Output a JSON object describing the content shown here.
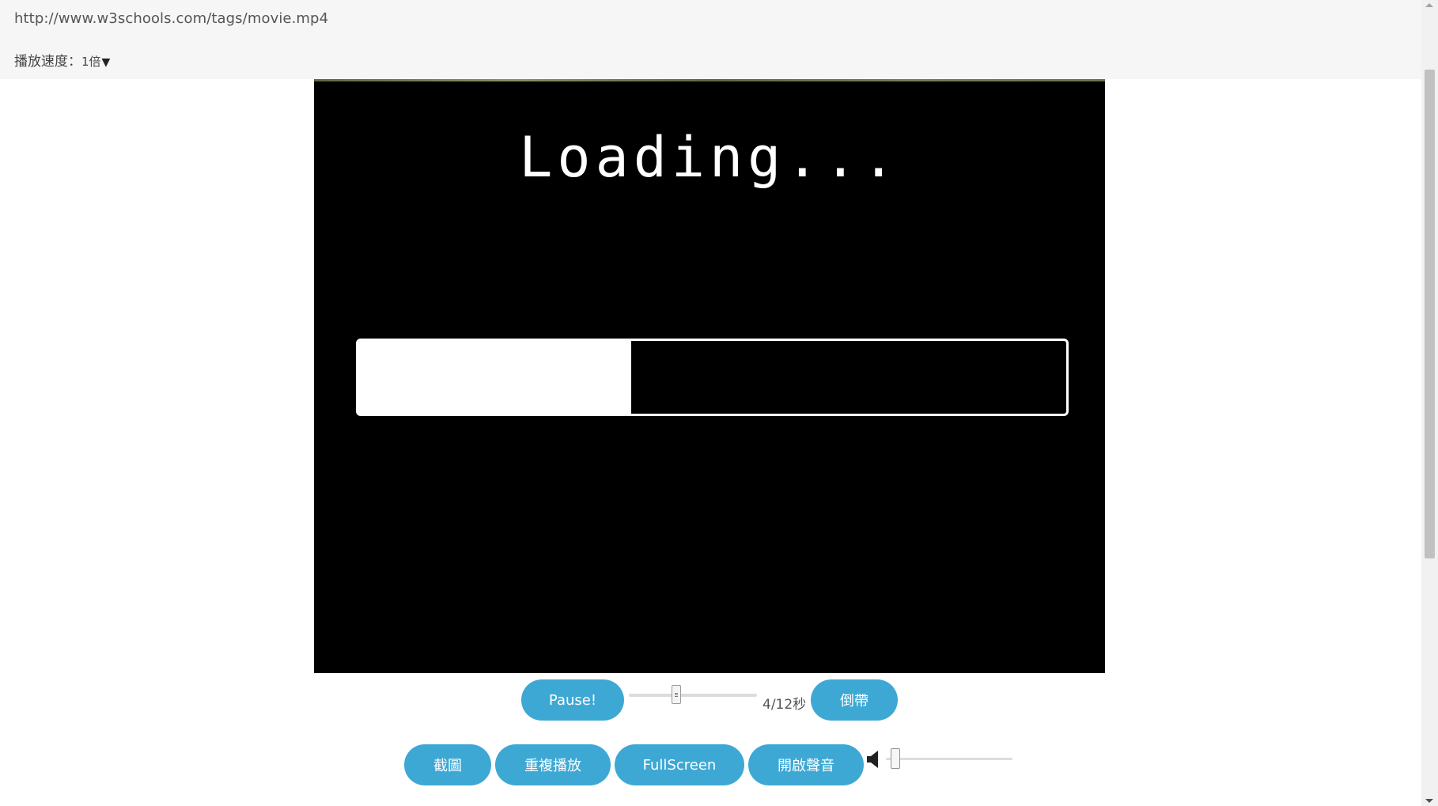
{
  "header": {
    "video_url": "http://www.w3schools.com/tags/movie.mp4",
    "speed_label": "播放速度：",
    "speed_value": "1倍",
    "speed_caret": "▼"
  },
  "video": {
    "loading_text": "Loading...",
    "loading_progress": 0.385
  },
  "controls": {
    "pause_label": "Pause!",
    "progress_fraction": 0.36,
    "time_display": "4/12秒",
    "rewind_label": "倒帶",
    "screenshot_label": "截圖",
    "repeat_label": "重複播放",
    "fullscreen_label": "FullScreen",
    "sound_label": "開啟聲音",
    "volume_level": 0.0,
    "volume_icon": "speaker-icon"
  },
  "colors": {
    "button_bg": "#3ea8d4",
    "button_text": "#ffffff",
    "video_bg": "#000000",
    "header_bg": "#f6f6f6"
  }
}
